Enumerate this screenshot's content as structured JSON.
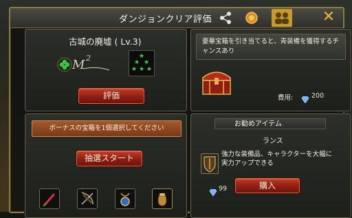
{
  "dialog": {
    "title": "ダンジョンクリア評価",
    "close_icon": "close-icon",
    "colors": {
      "accent": "#f2b23a",
      "button_red": "#8e1e14",
      "gold_border": "#8c7a3e"
    }
  },
  "dungeon": {
    "name": "古城の廃墟 ( Lv.3)",
    "rank_badge": "M",
    "rank_number": "2",
    "evaluate_label": "評価"
  },
  "treasure": {
    "description": "豪華宝箱を引き当てると、青装備を獲得するチャンスあり",
    "cost_label": "費用:",
    "cost_value": "200"
  },
  "bonus": {
    "banner": "ボーナスの宝箱を1個選択してください",
    "draw_label": "抽選スタート",
    "items": [
      {
        "icon": "red-dagger-icon"
      },
      {
        "icon": "crossbow-icon"
      },
      {
        "icon": "amulet-icon"
      },
      {
        "icon": "pouch-icon"
      }
    ]
  },
  "recommended": {
    "header": "お勧めアイテム",
    "item_name": "ランス",
    "item_desc": "強力な装備品、キャラクターを大幅に実力アップできる",
    "price": "99",
    "buy_label": "購入"
  }
}
